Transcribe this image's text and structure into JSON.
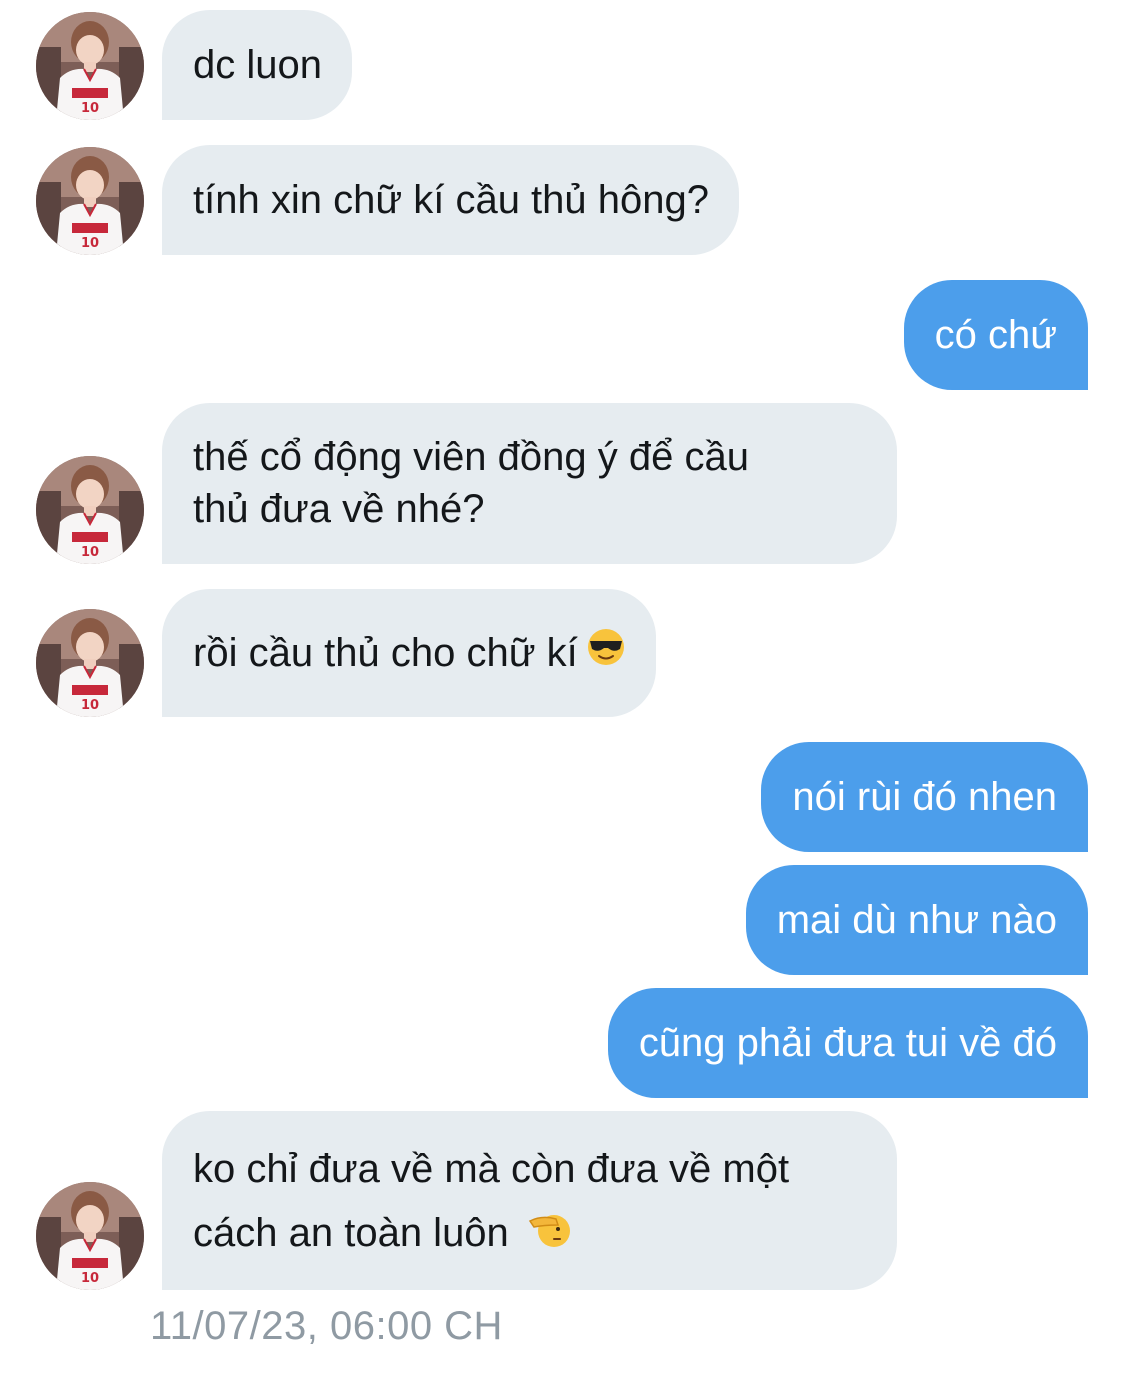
{
  "colors": {
    "incoming_bubble": "#e6ecf0",
    "outgoing_bubble": "#4c9eeb",
    "incoming_text": "#14171a",
    "outgoing_text": "#ffffff",
    "timestamp_text": "#8f9aa3"
  },
  "messages": [
    {
      "direction": "incoming",
      "text": "dc luon"
    },
    {
      "direction": "incoming",
      "text": "tính xin chữ kí cầu thủ hông?"
    },
    {
      "direction": "outgoing",
      "text": "có chứ"
    },
    {
      "direction": "incoming",
      "lines": [
        "thế cổ động viên đồng ý để cầu",
        "thủ đưa về nhé?"
      ]
    },
    {
      "direction": "incoming",
      "text": "rồi cầu thủ cho chữ kí",
      "emoji": "smiling-face-with-sunglasses"
    },
    {
      "direction": "outgoing",
      "text": "nói rùi đó nhen"
    },
    {
      "direction": "outgoing",
      "text": "mai dù như nào"
    },
    {
      "direction": "outgoing",
      "text": "cũng phải đưa tui về đó"
    },
    {
      "direction": "incoming",
      "lines": [
        "ko chỉ đưa về mà còn đưa về một",
        "cách an toàn luôn"
      ],
      "emoji": "saluting-face"
    }
  ],
  "avatar_icon": "basketball-player-avatar",
  "timestamp": "11/07/23, 06:00 CH"
}
